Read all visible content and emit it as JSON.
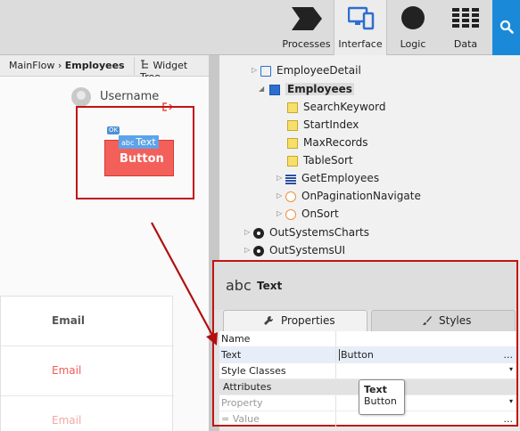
{
  "toolbar": {
    "tabs": [
      {
        "label": "Processes",
        "icon": "chevron-icon",
        "active": false
      },
      {
        "label": "Interface",
        "icon": "devices-icon",
        "active": true
      },
      {
        "label": "Logic",
        "icon": "circle-icon",
        "active": false
      },
      {
        "label": "Data",
        "icon": "table-icon",
        "active": false
      }
    ],
    "search_icon": "search-icon",
    "accent": "#1a8ad8"
  },
  "breadcrumb": {
    "flow": "MainFlow",
    "separator": " › ",
    "screen": "Employees"
  },
  "widget_tree_label": "Widget Tree",
  "canvas": {
    "username": "Username",
    "ok_badge": "OK",
    "text_chip_abc": "abc",
    "text_chip_label": "Text",
    "button_label": "Button",
    "table_rows": [
      "Email",
      "Email",
      "Email"
    ]
  },
  "tree": {
    "employee_detail": "EmployeeDetail",
    "employees": "Employees",
    "variables": [
      "SearchKeyword",
      "StartIndex",
      "MaxRecords",
      "TableSort"
    ],
    "aggregate": "GetEmployees",
    "actions": [
      "OnPaginationNavigate",
      "OnSort"
    ],
    "modules": [
      "OutSystemsCharts",
      "OutSystemsUI"
    ]
  },
  "properties": {
    "abc": "abc",
    "title": "Text",
    "tab_properties": "Properties",
    "tab_styles": "Styles",
    "rows": {
      "name_key": "Name",
      "name_val": "",
      "text_key": "Text",
      "text_val": "Button",
      "text_dots": "...",
      "style_key": "Style Classes",
      "style_dd": "▾",
      "attributes": "Attributes",
      "prop_key": "Property",
      "prop_dd": "▾",
      "value_key": "=  Value",
      "value_dots": "..."
    },
    "tooltip_title": "Text",
    "tooltip_value": "Button"
  },
  "colors": {
    "highlight": "#c11414",
    "button": "#f3605a"
  }
}
